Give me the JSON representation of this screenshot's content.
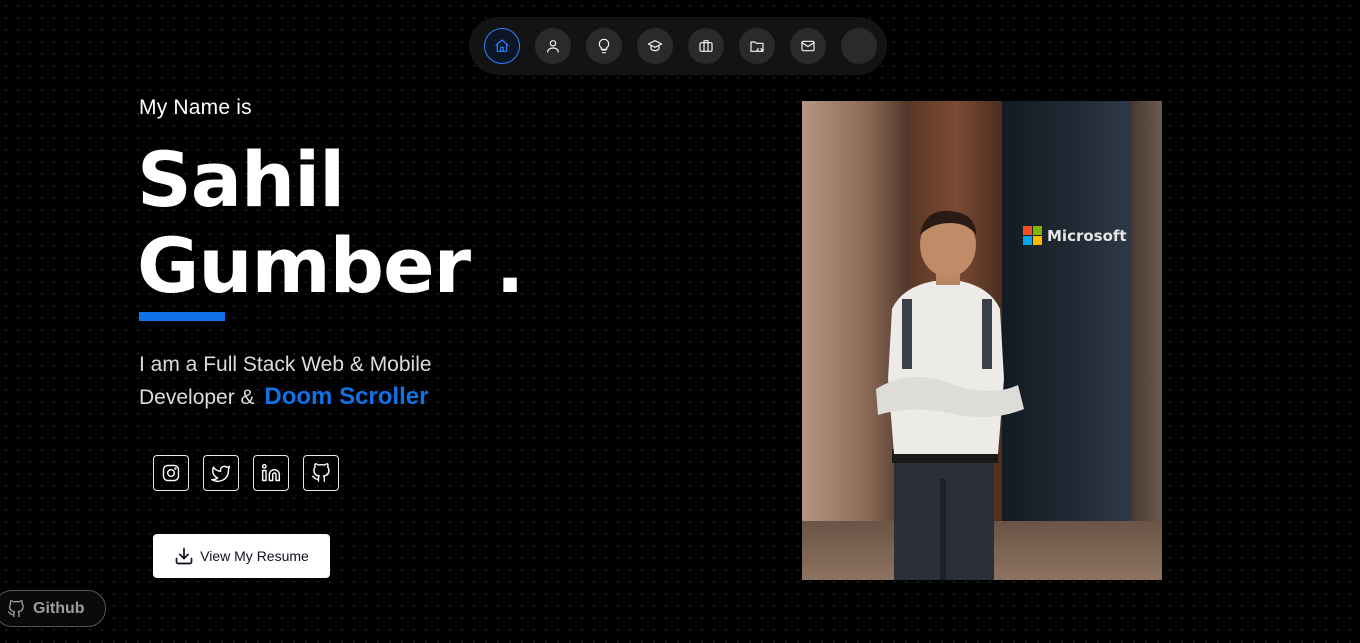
{
  "nav": {
    "items": [
      {
        "icon": "home-icon",
        "active": true
      },
      {
        "icon": "user-icon",
        "active": false
      },
      {
        "icon": "lightbulb-icon",
        "active": false
      },
      {
        "icon": "graduation-cap-icon",
        "active": false
      },
      {
        "icon": "briefcase-icon",
        "active": false
      },
      {
        "icon": "folder-code-icon",
        "active": false
      },
      {
        "icon": "mail-icon",
        "active": false
      },
      {
        "icon": "theme-toggle",
        "active": false
      }
    ]
  },
  "hero": {
    "intro": "My Name is",
    "first_name": "Sahil",
    "last_name": "Gumber .",
    "role_line1": "I am a Full Stack Web & Mobile",
    "role_line2_prefix": "Developer &",
    "role_highlight": "Doom Scroller"
  },
  "socials": [
    {
      "icon": "instagram-icon"
    },
    {
      "icon": "twitter-icon"
    },
    {
      "icon": "linkedin-icon"
    },
    {
      "icon": "github-icon"
    }
  ],
  "resume_button": {
    "label": "View My Resume",
    "icon": "download-icon"
  },
  "github_pill": {
    "label": "Github",
    "icon": "github-icon"
  },
  "photo": {
    "logo_text": "Microsoft"
  },
  "colors": {
    "accent": "#1072e6",
    "background": "#000000",
    "nav_bg": "#131313"
  }
}
